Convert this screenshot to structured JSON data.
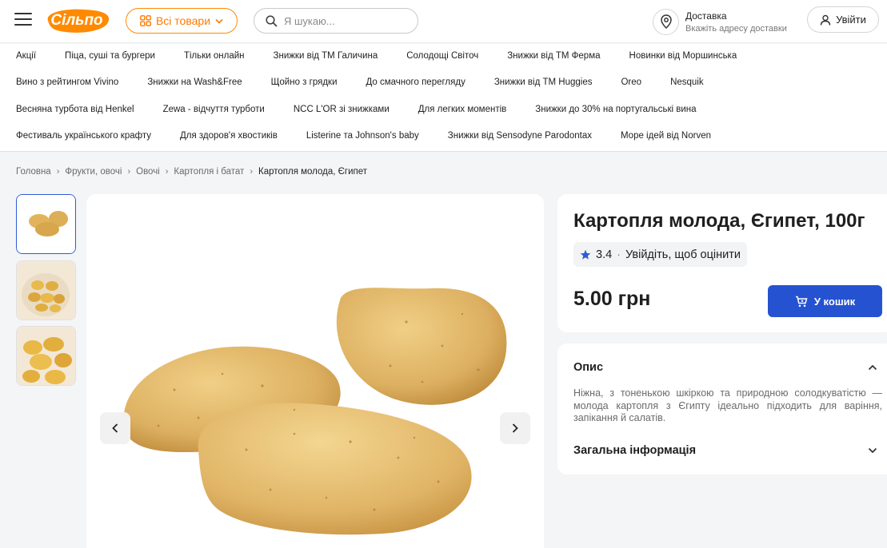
{
  "header": {
    "logo_text": "Сільпо",
    "all_goods_label": "Всі товари",
    "search_placeholder": "Я шукаю...",
    "delivery_title": "Доставка",
    "delivery_subtitle": "Вкажіть адресу доставки",
    "login_label": "Увійти"
  },
  "promo_nav": {
    "rows": [
      [
        "Акції",
        "Піца, суші та бургери",
        "Тільки онлайн",
        "Знижки від ТМ Галичина",
        "Солодощі Світоч",
        "Знижки від ТМ Ферма",
        "Новинки від Моршинська"
      ],
      [
        "Вино з рейтингом Vivino",
        "Знижки на Wash&Free",
        "Щойно з грядки",
        "До смачного перегляду",
        "Знижки від ТМ Huggies",
        "Oreo",
        "Nesquik"
      ],
      [
        "Весняна турбота від Henkel",
        "Zewa - відчуття турботи",
        "NCC L'OR зі знижками",
        "Для легких моментів",
        "Знижки до 30% на португальські вина"
      ],
      [
        "Фестиваль українського крафту",
        "Для здоров'я хвостиків",
        "Listerine та Johnson's baby",
        "Знижки від Sensodyne Parodontax",
        "Море ідей від Norven"
      ]
    ]
  },
  "breadcrumb": [
    "Головна",
    "Фрукти, овочі",
    "Овочі",
    "Картопля і батат",
    "Картопля молода, Єгипет"
  ],
  "product": {
    "title": "Картопля молода, Єгипет, 100г",
    "rating": "3.4",
    "rate_prompt": "Увійдіть, щоб оцінити",
    "price": "5.00 грн",
    "cart_label": "У кошик"
  },
  "description": {
    "heading": "Опис",
    "text": "Ніжна, з тоненькою шкіркою та природною солодкуватістю — молода картопля з Єгипту ідеально підходить для варіння, запікання й салатів.",
    "general_info_heading": "Загальна інформація"
  },
  "colors": {
    "brand_orange": "#ff7a00",
    "cart_blue": "#2552d0",
    "rating_star": "#2f5bd3"
  },
  "icons": [
    "menu-icon",
    "grid-icon",
    "chevron-down-icon",
    "search-icon",
    "location-pin-icon",
    "user-icon",
    "chevron-right-icon",
    "chevron-left-icon",
    "star-icon",
    "cart-icon",
    "chevron-up-icon"
  ]
}
